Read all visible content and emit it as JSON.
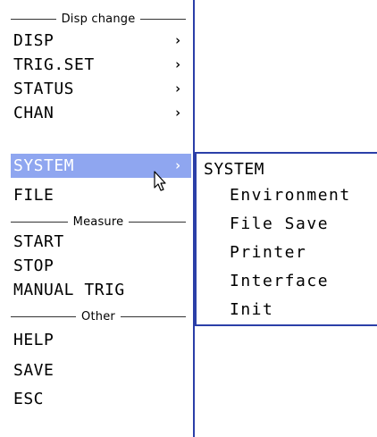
{
  "menu": {
    "disp_change_header": "Disp change",
    "disp": "DISP",
    "trig_set": "TRIG.SET",
    "status": "STATUS",
    "chan": "CHAN",
    "system": "SYSTEM",
    "file": "FILE",
    "measure_header": "Measure",
    "start": "START",
    "stop": "STOP",
    "manual_trig": "MANUAL TRIG",
    "other_header": "Other",
    "help": "HELP",
    "save": "SAVE",
    "esc": "ESC",
    "arrow": "›"
  },
  "submenu": {
    "title": "SYSTEM",
    "items": [
      "Environment",
      "File Save",
      "Printer",
      "Interface",
      "Init"
    ]
  },
  "colors": {
    "selected_bg": "#8fa6f0",
    "border": "#2b3fa8"
  }
}
